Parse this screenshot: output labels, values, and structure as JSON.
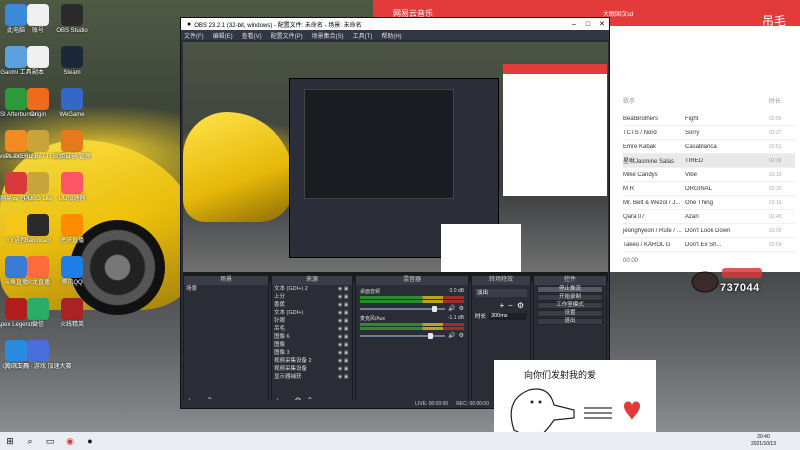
{
  "desktop": {
    "icons": [
      {
        "label": "此电脑",
        "icon": "computer-icon",
        "color": "#3b8ad9"
      },
      {
        "label": "账号",
        "icon": "document-icon",
        "color": "#f0f0f0"
      },
      {
        "label": "OBS Studio",
        "icon": "obs-icon",
        "color": "#2b2b2b"
      },
      {
        "label": "Gaomi\n工具",
        "icon": "folder-icon",
        "color": "#5ba0e0"
      },
      {
        "label": "副本",
        "icon": "document-icon",
        "color": "#f0f0f0"
      },
      {
        "label": "Steam",
        "icon": "steam-icon",
        "color": "#1b2838"
      },
      {
        "label": "MSI\nAfterburner",
        "icon": "msi-icon",
        "color": "#2d9a3a"
      },
      {
        "label": "Origin",
        "icon": "origin-icon",
        "color": "#f06a1c"
      },
      {
        "label": "WeGame",
        "icon": "wegame-icon",
        "color": "#3567c8"
      },
      {
        "label": "Nvidia\nGeForce",
        "icon": "nvidia-icon",
        "color": "#f18b20"
      },
      {
        "label": "PLAYERU\nBATTLEGR...",
        "icon": "pubg-icon",
        "color": "#c8a43a"
      },
      {
        "label": "火炬自营\n管理",
        "icon": "app-icon",
        "color": "#e37b1e"
      },
      {
        "label": "网易云\n音乐",
        "icon": "netease-music-icon",
        "color": "#d83a3a"
      },
      {
        "label": "PUBG\nLite",
        "icon": "pubg-icon",
        "color": "#c8a43a"
      },
      {
        "label": "UU加速器",
        "icon": "app-icon",
        "color": "#ff5566"
      },
      {
        "label": "YY语音",
        "icon": "yy-icon",
        "color": "#f5c518"
      },
      {
        "label": "Bandicam",
        "icon": "bandicam-icon",
        "color": "#2a2a2a"
      },
      {
        "label": "虎牙直播",
        "icon": "huya-icon",
        "color": "#ff8c00"
      },
      {
        "label": "斗鱼直播",
        "icon": "app-icon",
        "color": "#3a7bd5"
      },
      {
        "label": "火龙直播",
        "icon": "app-icon",
        "color": "#ff6b3d"
      },
      {
        "label": "腾讯QQ",
        "icon": "qq-icon",
        "color": "#1c7ee6"
      },
      {
        "label": "Apex\nLegends",
        "icon": "apex-icon",
        "color": "#b11c1c"
      },
      {
        "label": "微信",
        "icon": "wechat-icon",
        "color": "#2aae67"
      },
      {
        "label": "火线精英",
        "icon": "app-icon",
        "color": "#aa2222"
      },
      {
        "label": "QQ浏览器",
        "icon": "browser-icon",
        "color": "#2a8ce0"
      },
      {
        "label": "腾讯工具 · 游戏\n加速大赛",
        "icon": "app-icon",
        "color": "#4a6fdd"
      }
    ]
  },
  "music_app": {
    "logo": "网易云音乐",
    "user": "大眼国汉sd",
    "signature": "吊毛",
    "columns": {
      "artist": "歌手",
      "title": "",
      "time": "时长"
    },
    "rows": [
      {
        "artist": "BeatBrothers",
        "title": "Fight",
        "time": "02:56"
      },
      {
        "artist": "TCTS / Nord",
        "title": "Sorry",
        "time": "03:27"
      },
      {
        "artist": "Emre Kabak",
        "title": "Casablanca",
        "time": "02:51"
      },
      {
        "artist": "星咻Jasmine Salas",
        "title": "TIRED",
        "time": "02:38"
      },
      {
        "artist": "Mike Candys",
        "title": "Vibe",
        "time": "03:10"
      },
      {
        "artist": "M R",
        "title": "ORGINAL",
        "time": "02:35"
      },
      {
        "artist": "Mr. Belt & Wezol / J...",
        "title": "One Thing",
        "time": "03:16"
      },
      {
        "artist": "Qara 07",
        "title": "Azan",
        "time": "02:45"
      },
      {
        "artist": "jeonghyeon / Rute / ...",
        "title": "Don't Look Down",
        "time": "03:00"
      },
      {
        "artist": "Takeo / KAROL G",
        "title": "Don't Ex Sh...",
        "time": "02:54"
      }
    ],
    "footer_time": "00:00"
  },
  "obs": {
    "title": "OBS 23.2.1 (32-bit, windows) - 配置文件: 未命名 - 场景: 未命名",
    "menu": [
      "文件(F)",
      "编辑(E)",
      "查看(V)",
      "配置文件(P)",
      "场景集合(S)",
      "工具(T)",
      "帮助(H)"
    ],
    "docks": {
      "scenes": {
        "title": "场景",
        "items": [
          "场景"
        ]
      },
      "sources": {
        "title": "来源",
        "items": [
          "文本 (GDI+) 2",
          "上分",
          "香蕉",
          "文本 (GDI+)",
          "针眼",
          "吊毛",
          "图像 6",
          "图像",
          "图像 3",
          "视频采集设备 2",
          "视频采集设备",
          "显示器捕获"
        ]
      },
      "mixer": {
        "title": "混音器",
        "tracks": [
          {
            "name": "桌面音频",
            "db": "0.0 dB"
          },
          {
            "name": "麦克风/Aux",
            "db": "-1.1 dB"
          }
        ]
      },
      "transitions": {
        "title": "转场特效",
        "type": "淡出",
        "duration_label": "时长",
        "duration": "300ms"
      },
      "controls": {
        "title": "控件",
        "buttons": [
          "停止推流",
          "开始录制",
          "工作室模式",
          "设置",
          "退出"
        ]
      }
    },
    "status": {
      "live": "LIVE: 00:00:00",
      "rec": "REC: 00:00:00"
    }
  },
  "sticker": {
    "caption": "向你们发射我的爱"
  },
  "badge": {
    "number": "737044"
  },
  "taskbar": {
    "clock_time": "20:40",
    "clock_date": "2021/10/13"
  }
}
